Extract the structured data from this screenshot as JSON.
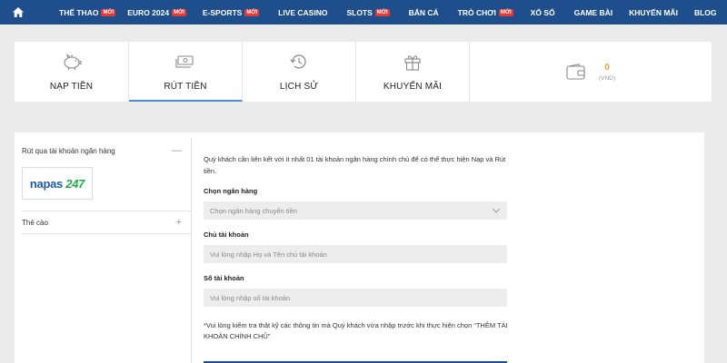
{
  "nav": {
    "items": [
      {
        "label": "THỂ THAO",
        "badge": "MỚI"
      },
      {
        "label": "EURO 2024",
        "badge": "MỚI"
      },
      {
        "label": "E-SPORTS",
        "badge": "MỚI"
      },
      {
        "label": "LIVE CASINO",
        "badge": ""
      },
      {
        "label": "SLOTS",
        "badge": "MỚI"
      },
      {
        "label": "BẮN CÁ",
        "badge": ""
      },
      {
        "label": "TRÒ CHƠI",
        "badge": "MỚI"
      },
      {
        "label": "XỔ SỐ",
        "badge": ""
      },
      {
        "label": "GAME BÀI",
        "badge": ""
      },
      {
        "label": "KHUYẾN MÃI",
        "badge": ""
      },
      {
        "label": "BLOG",
        "badge": ""
      }
    ],
    "home_icon": "home-icon",
    "bg_color": "#1f4e8c",
    "badge_color": "#e53935"
  },
  "tabs": [
    {
      "label": "NẠP TIỀN",
      "icon": "piggy-bank-icon"
    },
    {
      "label": "RÚT TIỀN",
      "icon": "cash-icon",
      "active": true
    },
    {
      "label": "LỊCH SỬ",
      "icon": "history-icon"
    },
    {
      "label": "KHUYẾN MÃI",
      "icon": "gift-icon"
    }
  ],
  "wallet": {
    "icon": "wallet-icon",
    "value": "0",
    "currency": "(VND)",
    "value_color": "#e8a33c"
  },
  "sidebar": {
    "bank_label": "Rút qua tài khoản ngân hàng",
    "bank_toggle": "—",
    "napas": {
      "main": "napas",
      "suffix": "247"
    },
    "card_label": "Thẻ cào",
    "card_toggle": "+"
  },
  "form": {
    "intro": "Quý khách cần liên kết với ít nhất 01 tài khoản ngân hàng chính chủ để có thể thực hiện Nạp và Rút tiền.",
    "bank_label": "Chọn ngân hàng",
    "bank_placeholder": "Chọn ngân hàng chuyển tiền",
    "owner_label": "Chủ tài khoản",
    "owner_placeholder": "Vui lòng nhập Họ và Tên chủ tài khoản",
    "account_label": "Số tài khoản",
    "account_placeholder": "Vui lòng nhập số tài khoản",
    "note": "*Vui lòng kiểm tra thật kỹ các thông tin mà Quý khách vừa nhập trước khi thực hiện chọn “THÊM TÀI KHOẢN CHÍNH CHỦ”"
  }
}
